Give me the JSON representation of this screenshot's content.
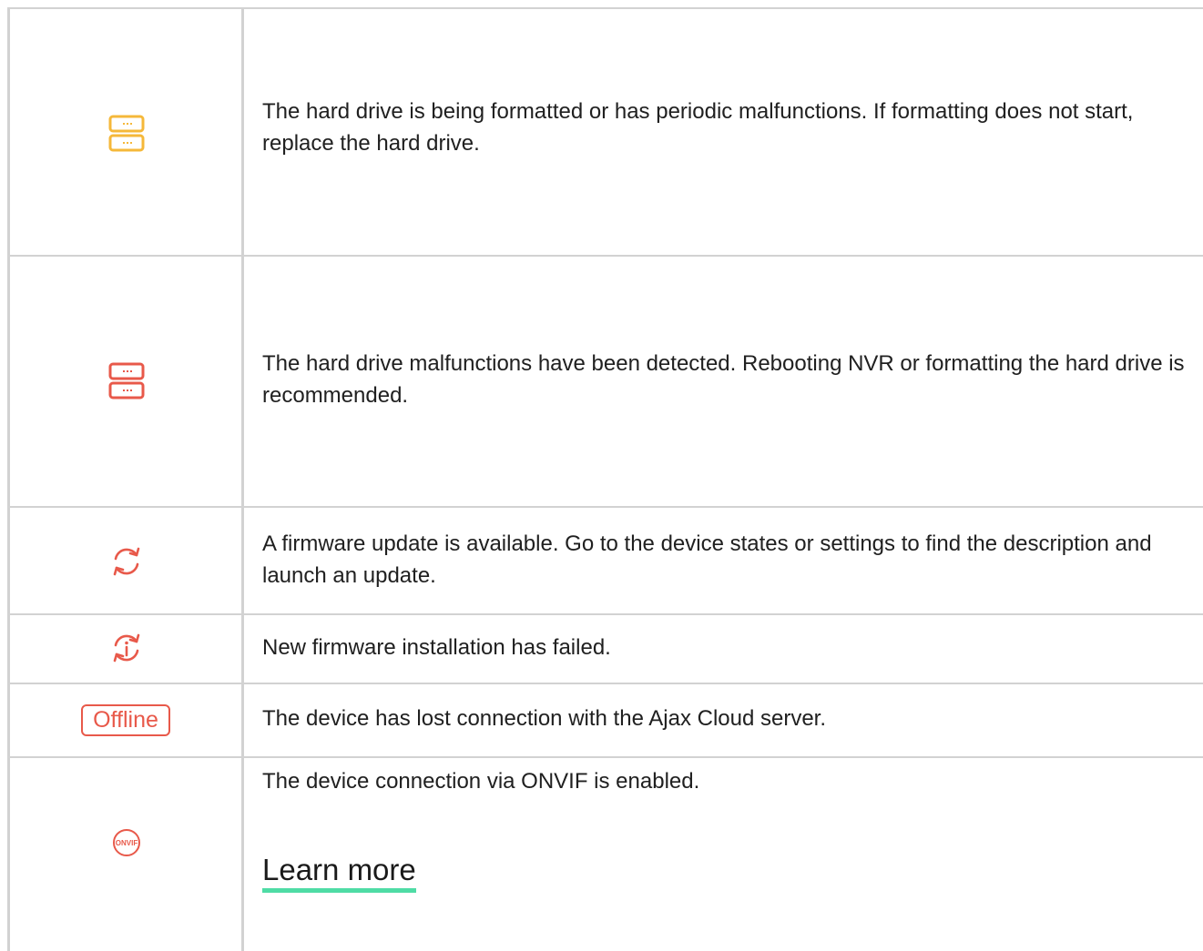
{
  "rows": [
    {
      "icon": "hard-drive-warning-icon",
      "icon_color": "#f5b83a",
      "description": "The hard drive is being formatted or has periodic malfunctions. If formatting does not start, replace the hard drive."
    },
    {
      "icon": "hard-drive-error-icon",
      "icon_color": "#e8594a",
      "description": "The hard drive malfunctions have been detected. Rebooting NVR or formatting the hard drive is recommended."
    },
    {
      "icon": "firmware-update-icon",
      "icon_color": "#e8594a",
      "description": "A firmware update is available. Go to the device states or settings to find the description and launch an update."
    },
    {
      "icon": "firmware-failed-icon",
      "icon_color": "#e8594a",
      "description": "New firmware installation has failed."
    },
    {
      "badge": "Offline",
      "badge_color": "#e8594a",
      "description": "The device has lost connection with the Ajax Cloud server."
    },
    {
      "icon": "onvif-icon",
      "icon_label": "ONVIF",
      "icon_color": "#e8594a",
      "description": "The device connection via ONVIF is enabled.",
      "link": "Learn more",
      "link_underline_color": "#4fdca5"
    }
  ],
  "colors": {
    "border": "#d2d2d2",
    "text": "#202020"
  }
}
